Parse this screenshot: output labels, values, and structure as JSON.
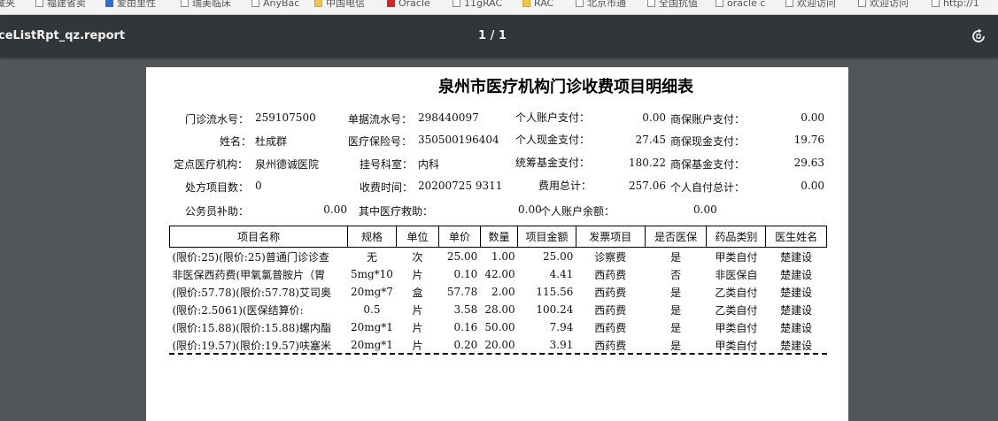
{
  "bookmarks": [
    {
      "label": "藏夹",
      "icon": "none"
    },
    {
      "label": "福建省卖",
      "icon": "page"
    },
    {
      "label": "爱由里性",
      "icon": "blue"
    },
    {
      "label": "瑞美临床",
      "icon": "page"
    },
    {
      "label": "AnyBac",
      "icon": "page"
    },
    {
      "label": "中国电信",
      "icon": "folder"
    },
    {
      "label": "Oracle",
      "icon": "red"
    },
    {
      "label": "11gRAC",
      "icon": "page"
    },
    {
      "label": "RAC",
      "icon": "folder"
    },
    {
      "label": "北京市通",
      "icon": "page"
    },
    {
      "label": "全国抗值",
      "icon": "page"
    },
    {
      "label": "oracle c",
      "icon": "page"
    },
    {
      "label": "欢迎访问",
      "icon": "page"
    },
    {
      "label": "欢迎访问",
      "icon": "page"
    },
    {
      "label": "http://1",
      "icon": "page"
    }
  ],
  "toolbar": {
    "title": "ceListRpt_qz.report",
    "pages": "1 / 1",
    "rotate_icon": "rotate-icon"
  },
  "report": {
    "title": "泉州市医疗机构门诊收费项目明细表",
    "fields": {
      "l_mzlsh": "门诊流水号：",
      "v_mzlsh": "259107500",
      "l_djlsh": "单据流水号：",
      "v_djlsh": "298440097",
      "l_grzhzf": "个人账户支付：",
      "v_grzhzf": "0.00",
      "l_sbzhzf": "商保账户支付：",
      "v_sbzhzf": "0.00",
      "l_xm": "姓名：",
      "v_xm": "杜成群",
      "l_ylbxh": "医疗保险号：",
      "v_ylbxh": "350500196404",
      "l_grxjzf": "个人现金支付：",
      "v_grxjzf": "27.45",
      "l_sbxjzf": "商保现金支付：",
      "v_sbxjzf": "19.76",
      "l_ddyljg": "定点医疗机构：",
      "v_ddyljg": "泉州德诚医院",
      "l_ghks": "挂号科室：",
      "v_ghks": "内科",
      "l_tcjjzf": "统筹基金支付：",
      "v_tcjjzf": "180.22",
      "l_sbjjzf": "商保基金支付：",
      "v_sbjjzf": "29.63",
      "l_cfxms": "处方项目数：",
      "v_cfxms": "0",
      "l_sfsj": "收费时间：",
      "v_sfsj": "20200725 9311",
      "l_fyzj": "费用总计：",
      "v_fyzj": "257.06",
      "l_grzfzj": "个人自付总计：",
      "v_grzfzj": "0.00",
      "l_gwybz": "公务员补助：",
      "v_gwybz": "0.00",
      "l_qzgrjz": "其中医疗救助：",
      "v_qzgrjz": "0.00",
      "l_grzhye": "个人账户余额：",
      "v_grzhye": "0.00"
    },
    "columns": [
      "项目名称",
      "规格",
      "单位",
      "单价",
      "数量",
      "项目金额",
      "发票项目",
      "是否医保",
      "药品类别",
      "医生姓名"
    ],
    "rows": [
      [
        "(限价:25)(限价:25)普通门诊诊查",
        "无",
        "次",
        "25.00",
        "1.00",
        "25.00",
        "诊察费",
        "是",
        "甲类自付",
        "楚建设"
      ],
      [
        "非医保西药费(甲氧氯普胺片（胃",
        "5mg*10",
        "片",
        "0.10",
        "42.00",
        "4.41",
        "西药费",
        "否",
        "非医保自",
        "楚建设"
      ],
      [
        "(限价:57.78)(限价:57.78)艾司奥",
        "20mg*7",
        "盒",
        "57.78",
        "2.00",
        "115.56",
        "西药费",
        "是",
        "乙类自付",
        "楚建设"
      ],
      [
        "(限价:2.5061)(医保结算价:",
        "0.5",
        "片",
        "3.58",
        "28.00",
        "100.24",
        "西药费",
        "是",
        "乙类自付",
        "楚建设"
      ],
      [
        "(限价:15.88)(限价:15.88)螺内酯",
        "20mg*1",
        "片",
        "0.16",
        "50.00",
        "7.94",
        "西药费",
        "是",
        "甲类自付",
        "楚建设"
      ],
      [
        "(限价:19.57)(限价:19.57)呋塞米",
        "20mg*1",
        "片",
        "0.20",
        "20.00",
        "3.91",
        "西药费",
        "是",
        "甲类自付",
        "楚建设"
      ]
    ]
  }
}
